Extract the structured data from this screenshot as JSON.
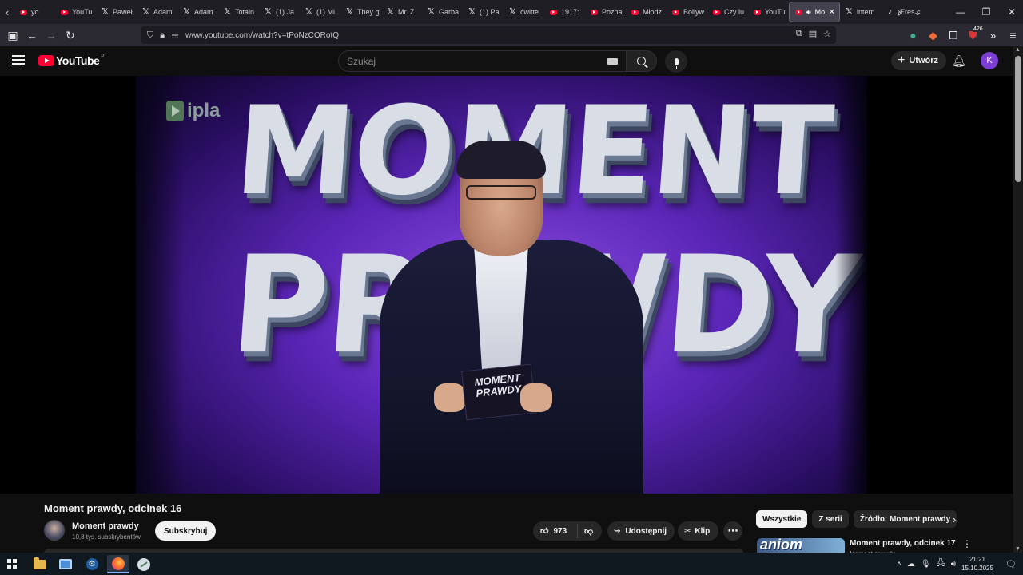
{
  "browser": {
    "tabs": [
      {
        "icon": "youtube",
        "label": "yo"
      },
      {
        "icon": "youtube",
        "label": "YouTu"
      },
      {
        "icon": "x",
        "label": "Paweł"
      },
      {
        "icon": "x",
        "label": "Adam"
      },
      {
        "icon": "x",
        "label": "Adam"
      },
      {
        "icon": "x",
        "label": "Totaln"
      },
      {
        "icon": "x",
        "label": "(1) Ja"
      },
      {
        "icon": "x",
        "label": "(1) Mi"
      },
      {
        "icon": "x",
        "label": "They g"
      },
      {
        "icon": "x",
        "label": "Mr. Ż"
      },
      {
        "icon": "x",
        "label": "Garba"
      },
      {
        "icon": "x",
        "label": "(1) Pa"
      },
      {
        "icon": "x",
        "label": "ćwitte"
      },
      {
        "icon": "youtube",
        "label": "1917:"
      },
      {
        "icon": "youtube",
        "label": "Pozna"
      },
      {
        "icon": "youtube",
        "label": "Młodz"
      },
      {
        "icon": "youtube",
        "label": "Bollyw"
      },
      {
        "icon": "youtube",
        "label": "Czy lu"
      },
      {
        "icon": "youtube",
        "label": "YouTu"
      },
      {
        "icon": "youtube",
        "label": "Mo",
        "active": true
      },
      {
        "icon": "x",
        "label": "intern"
      },
      {
        "icon": "tiktok",
        "label": "¡Eres c"
      }
    ],
    "url": "www.youtube.com/watch?v=tPoNzCORotQ",
    "extension_badge": "426"
  },
  "youtube": {
    "logo_text": "YouTube",
    "country_code": "PL",
    "search_placeholder": "Szukaj",
    "create_label": "Utwórz",
    "avatar_letter": "K",
    "video": {
      "watermark": "ipla",
      "title_line1": "MOMENT",
      "title_line2": "PRAWDY",
      "card_line1": "MOMENT",
      "card_line2": "PRAWDY"
    },
    "title": "Moment prawdy, odcinek 16",
    "channel": {
      "name": "Moment prawdy",
      "subscribers": "10,8 tys. subskrybentów",
      "subscribe_label": "Subskrybuj"
    },
    "actions": {
      "likes": "973",
      "share_label": "Udostępnij",
      "clip_label": "Klip",
      "more_label": "⋯"
    },
    "chips": [
      "Wszystkie",
      "Z serii",
      "Źródło: Moment prawdy"
    ],
    "recommended": [
      {
        "title": "Moment prawdy, odcinek 17",
        "channel": "Moment prawdy",
        "thumb_text": "aniom"
      }
    ]
  },
  "taskbar": {
    "time": "21:21",
    "date": "15.10.2025"
  },
  "colors": {
    "youtube_red": "#ff0033",
    "background": "#0f0f0f",
    "avatar_purple": "#7d3ed6",
    "video_purple": "#5b26b8"
  }
}
